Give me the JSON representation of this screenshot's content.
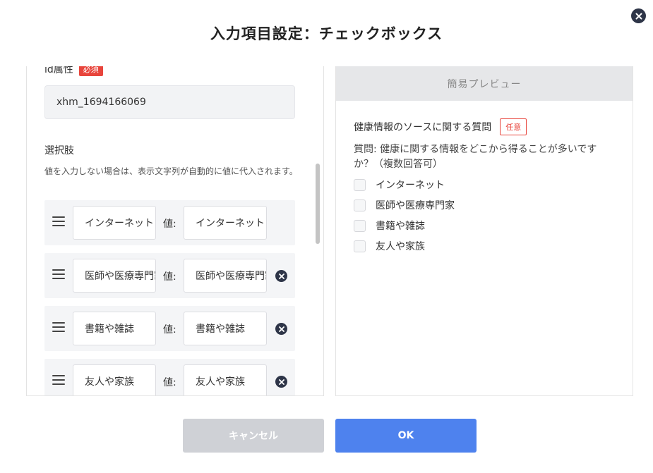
{
  "dialog": {
    "title": "入力項目設定：チェックボックス",
    "close_icon": "close-icon"
  },
  "editor": {
    "id_label": "id属性",
    "required_badge": "必須",
    "id_value": "xhm_1694166069",
    "options_title": "選択肢",
    "options_help": "値を入力しない場合は、表示文字列が自動的に値に代入されます。",
    "value_label": "値:",
    "options": [
      {
        "label": "インターネット",
        "value": "インターネット"
      },
      {
        "label": "医師や医療専門家",
        "value": "医師や医療専門家"
      },
      {
        "label": "書籍や雑誌",
        "value": "書籍や雑誌"
      },
      {
        "label": "友人や家族",
        "value": "友人や家族"
      }
    ]
  },
  "preview": {
    "header": "簡易プレビュー",
    "question_title": "健康情報のソースに関する質問",
    "optional_badge": "任意",
    "question_text": "質問: 健康に関する情報をどこから得ることが多いですか？（複数回答可）",
    "choices": [
      "インターネット",
      "医師や医療専門家",
      "書籍や雑誌",
      "友人や家族"
    ]
  },
  "footer": {
    "cancel_label": "キャンセル",
    "ok_label": "OK"
  },
  "colors": {
    "accent": "#4e82ee",
    "danger": "#e8453c",
    "dark_icon": "#2e3548",
    "cancel_bg": "#cfd1d6"
  }
}
